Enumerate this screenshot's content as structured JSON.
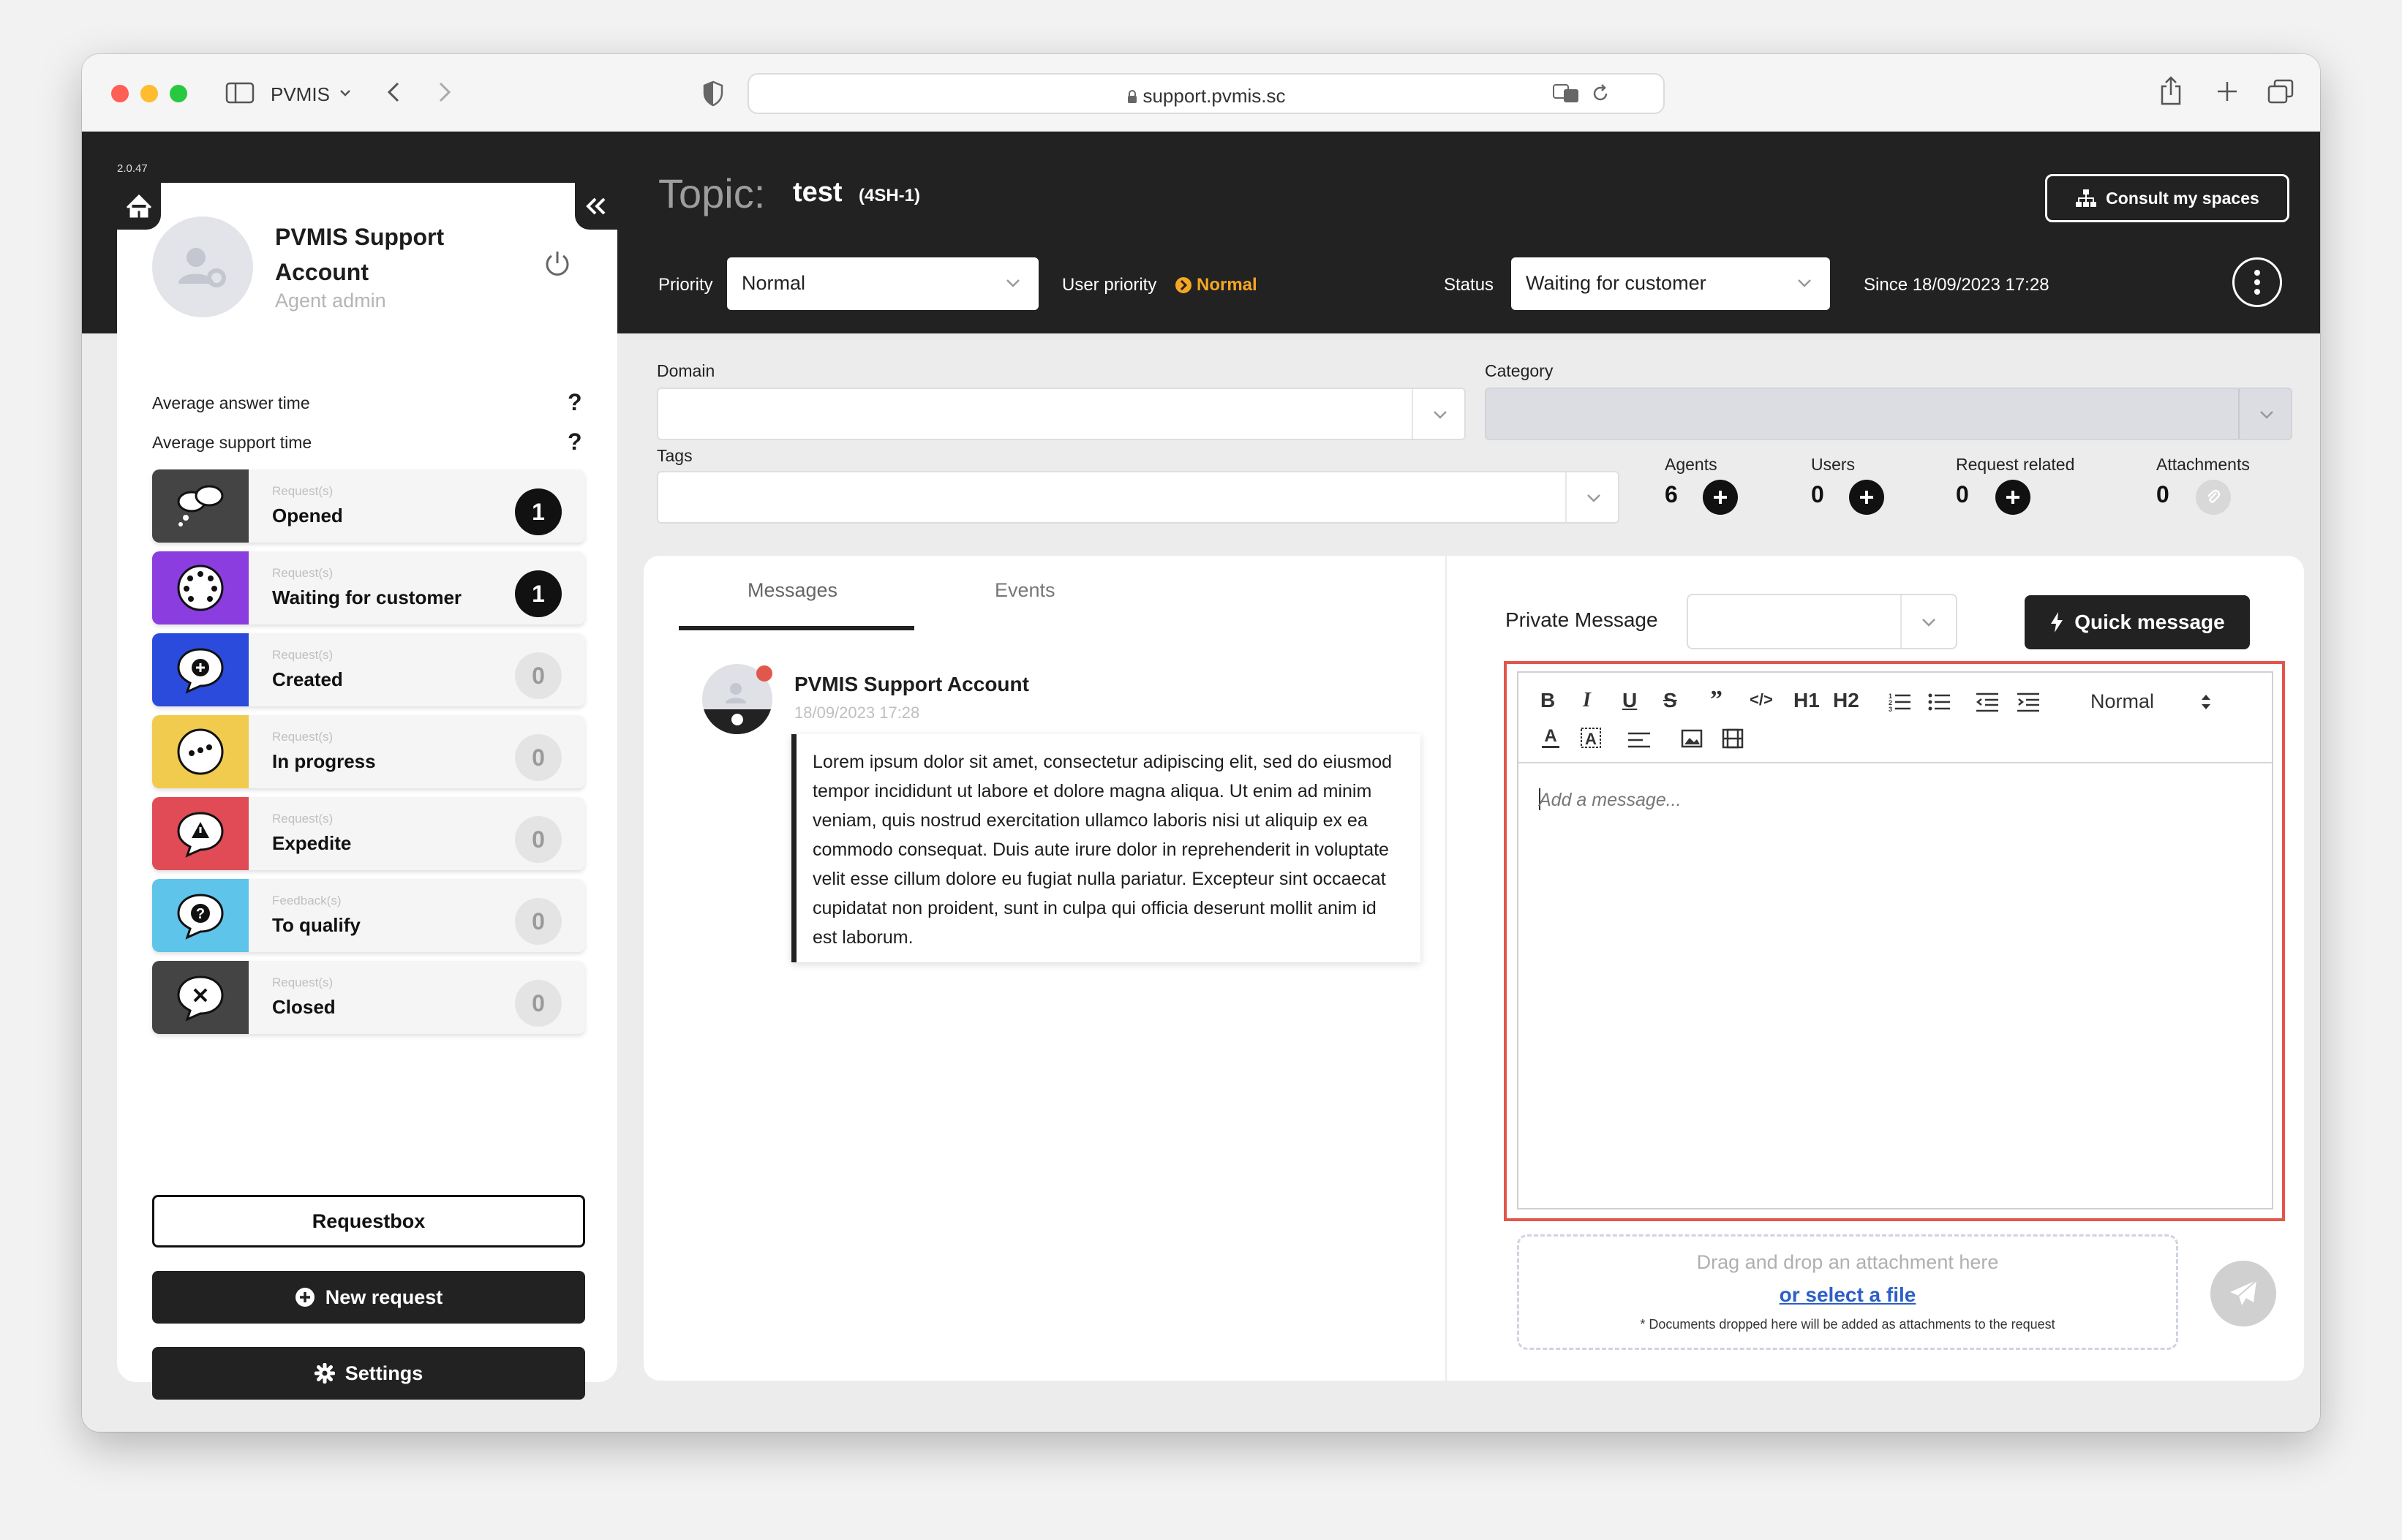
{
  "browser": {
    "app_name": "PVMIS",
    "url": "support.pvmis.sc"
  },
  "app": {
    "version": "2.0.47"
  },
  "account": {
    "name": "PVMIS Support Account",
    "role": "Agent admin",
    "metrics": [
      {
        "label": "Average answer time",
        "value": "?"
      },
      {
        "label": "Average support time",
        "value": "?"
      }
    ]
  },
  "stats": [
    {
      "sub": "Request(s)",
      "title": "Opened",
      "count": "1",
      "color": "#444444"
    },
    {
      "sub": "Request(s)",
      "title": "Waiting for customer",
      "count": "1",
      "color": "#8b3de0"
    },
    {
      "sub": "Request(s)",
      "title": "Created",
      "count": "0",
      "color": "#2b4bdc"
    },
    {
      "sub": "Request(s)",
      "title": "In progress",
      "count": "0",
      "color": "#f1cb4e"
    },
    {
      "sub": "Request(s)",
      "title": "Expedite",
      "count": "0",
      "color": "#e04b55"
    },
    {
      "sub": "Feedback(s)",
      "title": "To qualify",
      "count": "0",
      "color": "#5ec4ea"
    },
    {
      "sub": "Request(s)",
      "title": "Closed",
      "count": "0",
      "color": "#444444"
    }
  ],
  "sidebar_buttons": {
    "requestbox": "Requestbox",
    "new_request": "New request",
    "settings": "Settings"
  },
  "topic": {
    "label": "Topic:",
    "title": "test",
    "id": "(4SH-1)",
    "consult_label": "Consult my spaces",
    "priority_label": "Priority",
    "priority_value": "Normal",
    "user_priority_label": "User priority",
    "user_priority_value": "Normal",
    "status_label": "Status",
    "status_value": "Waiting for customer",
    "since": "Since 18/09/2023 17:28"
  },
  "fields": {
    "domain_label": "Domain",
    "category_label": "Category",
    "tags_label": "Tags"
  },
  "counters": [
    {
      "label": "Agents",
      "value": "6"
    },
    {
      "label": "Users",
      "value": "0"
    },
    {
      "label": "Request related",
      "value": "0"
    },
    {
      "label": "Attachments",
      "value": "0"
    }
  ],
  "tabs": [
    "Messages",
    "Events"
  ],
  "message": {
    "author": "PVMIS Support Account",
    "date": "18/09/2023 17:28",
    "body": "Lorem ipsum dolor sit amet, consectetur adipiscing elit, sed do eiusmod tempor incididunt ut labore et dolore magna aliqua. Ut enim ad minim veniam, quis nostrud exercitation ullamco laboris nisi ut aliquip ex ea commodo consequat. Duis aute irure dolor in reprehenderit in voluptate velit esse cillum dolore eu fugiat nulla pariatur. Excepteur sint occaecat cupidatat non proident, sunt in culpa qui officia deserunt mollit anim id est laborum."
  },
  "composer": {
    "private_label": "Private Message",
    "quick_label": "Quick message",
    "heading_select": "Normal",
    "h1": "H1",
    "h2": "H2",
    "placeholder": "Add a message...",
    "drop_text": "Drag and drop an attachment here",
    "select_file": "or select a file",
    "drop_note": "* Documents dropped here will be added as attachments to the request"
  },
  "colors": {
    "dark": "#222222",
    "accent_orange": "#f5a623",
    "link_blue": "#2c5ec7",
    "highlight_red": "#e2574c"
  }
}
